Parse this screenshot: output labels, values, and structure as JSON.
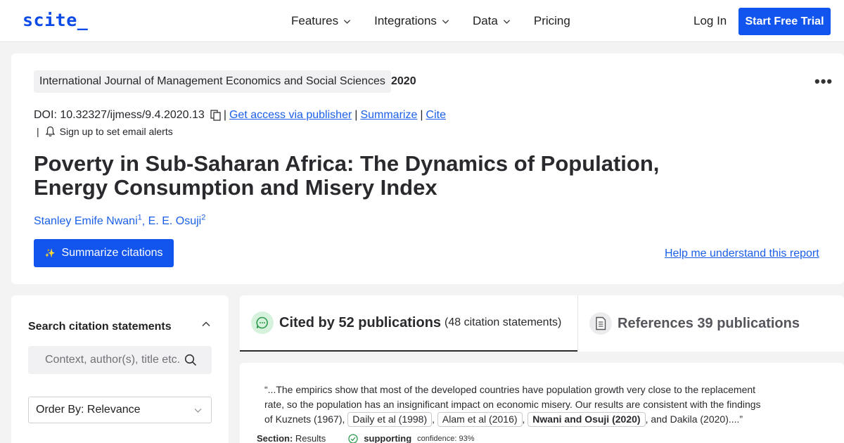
{
  "header": {
    "logo": "scite_",
    "nav": [
      {
        "label": "Features",
        "has_dropdown": true
      },
      {
        "label": "Integrations",
        "has_dropdown": true
      },
      {
        "label": "Data",
        "has_dropdown": true
      },
      {
        "label": "Pricing",
        "has_dropdown": false
      }
    ],
    "login": "Log In",
    "cta": "Start Free Trial"
  },
  "report": {
    "journal": "International Journal of Management Economics and Social Sciences",
    "year": "2020",
    "more": "•••",
    "doi_label": "DOI: 10.32327/ijmess/9.4.2020.13",
    "access_link": "Get access via publisher",
    "summarize_link": "Summarize",
    "cite_link": "Cite",
    "sep": "|",
    "alerts_label": "Sign up to set email alerts",
    "title": "Poverty in Sub-Saharan Africa: The Dynamics of Population, Energy Consumption and Misery Index",
    "authors": [
      {
        "name": "Stanley Emife Nwani",
        "sup": "1"
      },
      {
        "name": "E. E. Osuji",
        "sup": "2"
      }
    ],
    "summarize_citations": "Summarize citations",
    "help_link": "Help me understand this report"
  },
  "sidebar": {
    "title": "Search citation statements",
    "search_placeholder": "Context, author(s), title etc.",
    "order_by": "Order By: Relevance"
  },
  "tabs": {
    "cited": {
      "label": "Cited by 52 publications",
      "sub": "(48 citation statements)"
    },
    "references": {
      "label": "References 39 publications"
    }
  },
  "statement": {
    "text_before": "“...The empirics show that most of the developed countries have population growth very close to the replacement rate, so the population has an insignificant impact on economic misery. Our results are consistent with the findings of Kuznets (1967),",
    "chip1": "Daily et al (1998)",
    "chip2": "Alam et al (2016)",
    "chip3": "Nwani and Osuji (2020)",
    "text_after": ", and Dakila (2020)....”",
    "comma": ",",
    "section_label": "Section:",
    "section_value": "Results",
    "classification": "supporting",
    "confidence": "confidence: 93%"
  },
  "colors": {
    "brand": "#1155ee",
    "link": "#1b5fe8",
    "supporting": "#2e9b4e"
  }
}
